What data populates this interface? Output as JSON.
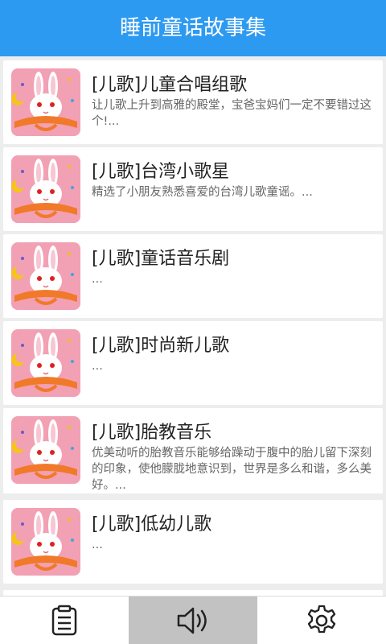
{
  "header": {
    "title": "睡前童话故事集"
  },
  "items": [
    {
      "title": "[儿歌]儿童合唱组歌",
      "desc": "让儿歌上升到高雅的殿堂，宝爸宝妈们一定不要错过这个!..."
    },
    {
      "title": "[儿歌]台湾小歌星",
      "desc": "精选了小朋友熟悉喜爱的台湾儿歌童谣。..."
    },
    {
      "title": "[儿歌]童话音乐剧",
      "desc": "..."
    },
    {
      "title": "[儿歌]时尚新儿歌",
      "desc": "..."
    },
    {
      "title": "[儿歌]胎教音乐",
      "desc": "优美动听的胎教音乐能够给躁动于腹中的胎儿留下深刻的印象，使他朦胧地意识到，世界是多么和谐，多么美好。..."
    },
    {
      "title": "[儿歌]低幼儿歌",
      "desc": "..."
    }
  ],
  "tabs": [
    {
      "name": "clipboard-icon",
      "active": false
    },
    {
      "name": "speaker-icon",
      "active": true
    },
    {
      "name": "gear-icon",
      "active": false
    }
  ],
  "colors": {
    "header": "#2d9af1",
    "thumb_bg": "#f2a0b4",
    "book": "#f07a2a",
    "active_tab": "#c2c2c2"
  }
}
